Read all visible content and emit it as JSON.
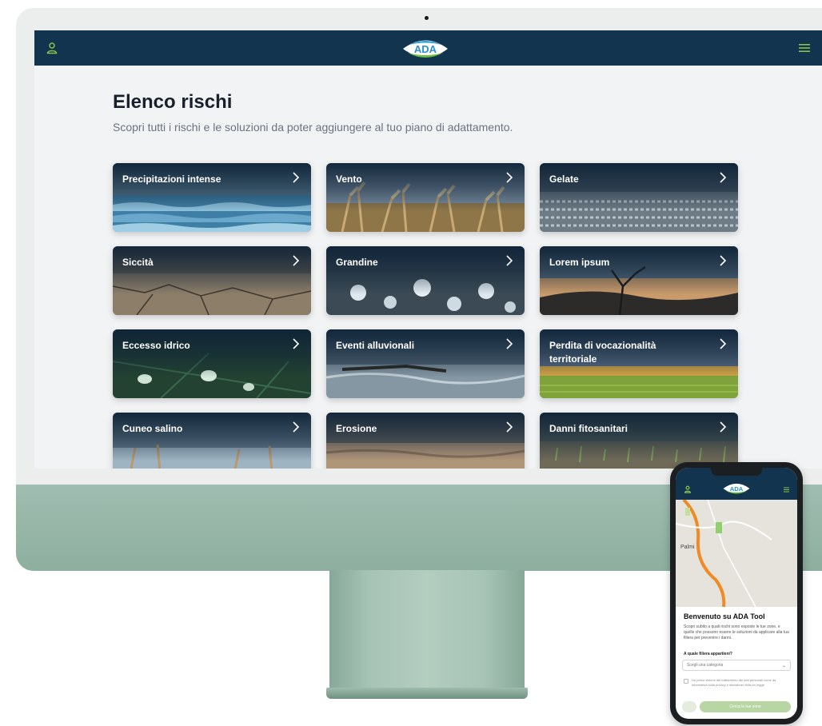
{
  "app": {
    "logo_text": "ADA",
    "colors": {
      "topbar": "#12344f",
      "accent_green": "#8bc34a",
      "page_bg": "#f2f3f4",
      "chin": "#9fbdb0"
    }
  },
  "header": {
    "user_icon": "user-icon",
    "menu_icon": "hamburger-menu-icon"
  },
  "main": {
    "title": "Elenco rischi",
    "subtitle": "Scopri tutti i rischi e le soluzioni  da poter aggiungere al tuo piano di adattamento.",
    "cards": [
      {
        "label": "Precipitazioni intense",
        "theme": "water"
      },
      {
        "label": "Vento",
        "theme": "reeds"
      },
      {
        "label": "Gelate",
        "theme": "frost"
      },
      {
        "label": "Siccità",
        "theme": "drought"
      },
      {
        "label": "Grandine",
        "theme": "hail"
      },
      {
        "label": "Lorem ipsum",
        "theme": "sunset"
      },
      {
        "label": "Eccesso idrico",
        "theme": "leaf"
      },
      {
        "label": "Eventi alluvionali",
        "theme": "flood"
      },
      {
        "label": "Perdita di vocazionalità territoriale",
        "theme": "field"
      },
      {
        "label": "Cuneo salino",
        "theme": "lake"
      },
      {
        "label": "Erosione",
        "theme": "erosion"
      },
      {
        "label": "Danni fitosanitari",
        "theme": "crops"
      }
    ]
  },
  "phone": {
    "logo_text": "ADA",
    "map_labels": [
      "Palmi"
    ],
    "welcome_title": "Benvenuto su  ADA Tool",
    "welcome_text": "Scopri subito a quali rischi sono esposte le tue zone, e quelle che possono essere le soluzioni da applicare alla tua filiera per prevenire i danni.",
    "question": "A quale filiera appartieni?",
    "select_placeholder": "Scegli una categoria",
    "consent_text": "Ho preso visione del trattamento dei dati personali come da informativa sulla privacy e disclaimer della ex legge",
    "cta_label": "Cerca le tue zone"
  }
}
